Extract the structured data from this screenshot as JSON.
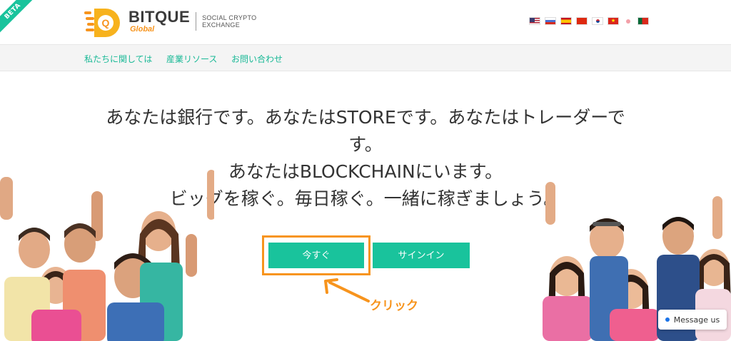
{
  "header": {
    "beta_label": "BETA",
    "brand": "BITQUE",
    "brand_sub": "Global",
    "tagline": "SOCIAL CRYPTO EXCHANGE",
    "languages": [
      {
        "icon": "flag-us-icon"
      },
      {
        "icon": "flag-ru-icon"
      },
      {
        "icon": "flag-es-icon"
      },
      {
        "icon": "flag-cn-icon"
      },
      {
        "icon": "flag-kr-icon"
      },
      {
        "icon": "flag-vn-icon"
      },
      {
        "icon": "flag-jp-icon"
      },
      {
        "icon": "flag-pt-icon"
      }
    ]
  },
  "nav": {
    "items": [
      "私たちに関しては",
      "産業リソース",
      "お問い合わせ"
    ]
  },
  "hero": {
    "lines": [
      "あなたは銀行です。あなたはSTOREです。あなたはトレーダーで",
      "す。",
      "あなたはBLOCKCHAINにいます。",
      "ビッグを稼ぐ。毎日稼ぐ。一緒に稼ぎましょう。"
    ],
    "primary_button": "今すぐ",
    "secondary_button": "サインイン",
    "annotation": "クリック"
  },
  "chat": {
    "label": "Message us"
  },
  "colors": {
    "accent": "#19c39c",
    "highlight": "#f7941d"
  }
}
